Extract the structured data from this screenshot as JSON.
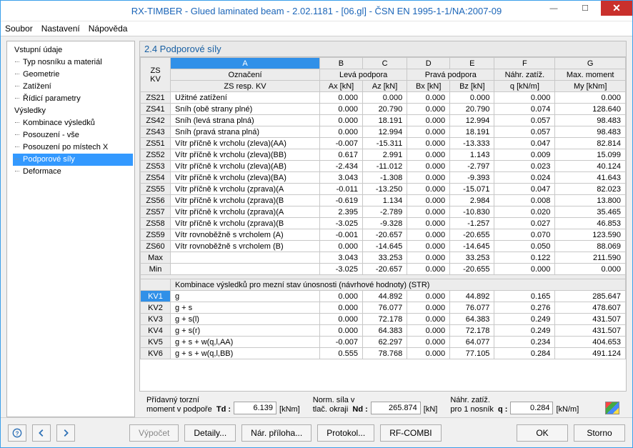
{
  "window": {
    "title": "RX-TIMBER - Glued laminated beam - 2.02.1181 - [06.gl] - ČSN EN 1995-1-1/NA:2007-09"
  },
  "menu": {
    "items": [
      "Soubor",
      "Nastavení",
      "Nápověda"
    ]
  },
  "nav": {
    "roots": [
      {
        "label": "Vstupní údaje",
        "children": [
          "Typ nosníku a materiál",
          "Geometrie",
          "Zatížení",
          "Řídicí parametry"
        ]
      },
      {
        "label": "Výsledky",
        "children": [
          "Kombinace výsledků",
          "Posouzení - vše",
          "Posouzení po místech X",
          "Podporové síly",
          "Deformace"
        ],
        "selected": "Podporové síly"
      }
    ]
  },
  "panel": {
    "title": "2.4 Podporové síly"
  },
  "columns": {
    "letters": [
      "A",
      "B",
      "C",
      "D",
      "E",
      "F",
      "G"
    ],
    "group_left_header": [
      "ZS",
      "KV"
    ],
    "groups": {
      "oznac": "Označení",
      "oznac_sub": "ZS resp. KV",
      "leva": "Levá podpora",
      "prava": "Pravá podpora",
      "nahr": "Náhr. zatíž.",
      "max": "Max. moment"
    },
    "subs": {
      "ax": "Ax [kN]",
      "az": "Az [kN]",
      "bx": "Bx [kN]",
      "bz": "Bz [kN]",
      "q": "q [kN/m]",
      "my": "My [kNm]"
    }
  },
  "rows_zs": [
    {
      "id": "ZS21",
      "label": "Užitné zatížení",
      "ax": "0.000",
      "az": "0.000",
      "bx": "0.000",
      "bz": "0.000",
      "q": "0.000",
      "my": "0.000"
    },
    {
      "id": "ZS41",
      "label": "Sníh (obě strany plné)",
      "ax": "0.000",
      "az": "20.790",
      "bx": "0.000",
      "bz": "20.790",
      "q": "0.074",
      "my": "128.640"
    },
    {
      "id": "ZS42",
      "label": "Sníh (levá strana plná)",
      "ax": "0.000",
      "az": "18.191",
      "bx": "0.000",
      "bz": "12.994",
      "q": "0.057",
      "my": "98.483"
    },
    {
      "id": "ZS43",
      "label": "Sníh (pravá strana plná)",
      "ax": "0.000",
      "az": "12.994",
      "bx": "0.000",
      "bz": "18.191",
      "q": "0.057",
      "my": "98.483"
    },
    {
      "id": "ZS51",
      "label": "Vítr příčně k vrcholu (zleva)(AA)",
      "ax": "-0.007",
      "az": "-15.311",
      "bx": "0.000",
      "bz": "-13.333",
      "q": "0.047",
      "my": "82.814"
    },
    {
      "id": "ZS52",
      "label": "Vítr příčně k vrcholu (zleva)(BB)",
      "ax": "0.617",
      "az": "2.991",
      "bx": "0.000",
      "bz": "1.143",
      "q": "0.009",
      "my": "15.099"
    },
    {
      "id": "ZS53",
      "label": "Vítr příčně k vrcholu (zleva)(AB)",
      "ax": "-2.434",
      "az": "-11.012",
      "bx": "0.000",
      "bz": "-2.797",
      "q": "0.023",
      "my": "40.124"
    },
    {
      "id": "ZS54",
      "label": "Vítr příčně k vrcholu (zleva)(BA)",
      "ax": "3.043",
      "az": "-1.308",
      "bx": "0.000",
      "bz": "-9.393",
      "q": "0.024",
      "my": "41.643"
    },
    {
      "id": "ZS55",
      "label": "Vítr příčně k vrcholu (zprava)(A",
      "ax": "-0.011",
      "az": "-13.250",
      "bx": "0.000",
      "bz": "-15.071",
      "q": "0.047",
      "my": "82.023"
    },
    {
      "id": "ZS56",
      "label": "Vítr příčně k vrcholu (zprava)(B",
      "ax": "-0.619",
      "az": "1.134",
      "bx": "0.000",
      "bz": "2.984",
      "q": "0.008",
      "my": "13.800"
    },
    {
      "id": "ZS57",
      "label": "Vítr příčně k vrcholu (zprava)(A",
      "ax": "2.395",
      "az": "-2.789",
      "bx": "0.000",
      "bz": "-10.830",
      "q": "0.020",
      "my": "35.465"
    },
    {
      "id": "ZS58",
      "label": "Vítr příčně k vrcholu (zprava)(B",
      "ax": "-3.025",
      "az": "-9.328",
      "bx": "0.000",
      "bz": "-1.257",
      "q": "0.027",
      "my": "46.853"
    },
    {
      "id": "ZS59",
      "label": "Vítr rovnoběžně s vrcholem (A)",
      "ax": "-0.001",
      "az": "-20.657",
      "bx": "0.000",
      "bz": "-20.655",
      "q": "0.070",
      "my": "123.590"
    },
    {
      "id": "ZS60",
      "label": "Vítr rovnoběžně s vrcholem (B)",
      "ax": "0.000",
      "az": "-14.645",
      "bx": "0.000",
      "bz": "-14.645",
      "q": "0.050",
      "my": "88.069"
    }
  ],
  "rows_summary": [
    {
      "id": "Max",
      "label": "",
      "ax": "3.043",
      "az": "33.253",
      "bx": "0.000",
      "bz": "33.253",
      "q": "0.122",
      "my": "211.590"
    },
    {
      "id": "Min",
      "label": "",
      "ax": "-3.025",
      "az": "-20.657",
      "bx": "0.000",
      "bz": "-20.655",
      "q": "0.000",
      "my": "0.000"
    }
  ],
  "section2_title": "Kombinace výsledků pro mezní stav únosnosti (návrhové hodnoty) (STR)",
  "rows_kv": [
    {
      "id": "KV1",
      "label": "g",
      "ax": "0.000",
      "az": "44.892",
      "bx": "0.000",
      "bz": "44.892",
      "q": "0.165",
      "my": "285.647",
      "sel": true
    },
    {
      "id": "KV2",
      "label": "g + s",
      "ax": "0.000",
      "az": "76.077",
      "bx": "0.000",
      "bz": "76.077",
      "q": "0.276",
      "my": "478.607"
    },
    {
      "id": "KV3",
      "label": "g + s(l)",
      "ax": "0.000",
      "az": "72.178",
      "bx": "0.000",
      "bz": "64.383",
      "q": "0.249",
      "my": "431.507"
    },
    {
      "id": "KV4",
      "label": "g + s(r)",
      "ax": "0.000",
      "az": "64.383",
      "bx": "0.000",
      "bz": "72.178",
      "q": "0.249",
      "my": "431.507"
    },
    {
      "id": "KV5",
      "label": "g + s + w(q,l,AA)",
      "ax": "-0.007",
      "az": "62.297",
      "bx": "0.000",
      "bz": "64.077",
      "q": "0.234",
      "my": "404.653"
    },
    {
      "id": "KV6",
      "label": "g + s + w(q,l,BB)",
      "ax": "0.555",
      "az": "78.768",
      "bx": "0.000",
      "bz": "77.105",
      "q": "0.284",
      "my": "491.124"
    }
  ],
  "bottom": {
    "torsion_label1": "Přídavný torzní",
    "torsion_label2": "moment v podpoře",
    "torsion_sym": "Td :",
    "torsion_val": "6.139",
    "torsion_unit": "[kNm]",
    "norm_label1": "Norm. síla v",
    "norm_label2": "tlač. okraji",
    "norm_sym": "Nd :",
    "norm_val": "265.874",
    "norm_unit": "[kN]",
    "nahr_label1": "Náhr. zatíž.",
    "nahr_label2": "pro 1 nosník",
    "nahr_sym": "q :",
    "nahr_val": "0.284",
    "nahr_unit": "[kN/m]"
  },
  "footer": {
    "vypocet": "Výpočet",
    "detaily": "Detaily...",
    "narpriloha": "Nár. příloha...",
    "protokol": "Protokol...",
    "rfcombi": "RF-COMBI",
    "ok": "OK",
    "storno": "Storno"
  }
}
